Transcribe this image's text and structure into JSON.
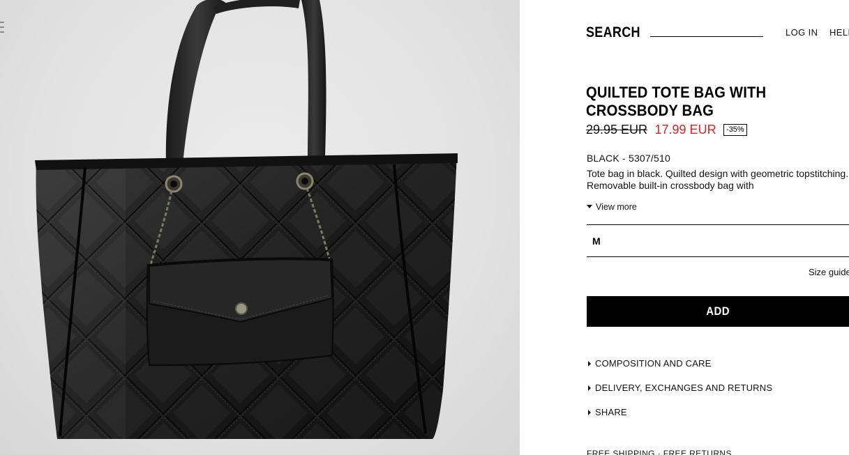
{
  "header": {
    "search_label": "SEARCH",
    "login_label": "LOG IN",
    "help_label": "HELP"
  },
  "product": {
    "title": "QUILTED TOTE BAG WITH CROSSBODY BAG",
    "old_price": "29.95 EUR",
    "new_price": "17.99 EUR",
    "discount": "-35%",
    "color_ref": "BLACK - 5307/510",
    "description": "Tote bag in black. Quilted design with geometric topstitching. Removable built-in crossbody bag with",
    "view_more_label": "View more",
    "selected_size": "M",
    "size_guide_label": "Size guide",
    "add_label": "ADD"
  },
  "accordion": [
    {
      "label": "COMPOSITION AND CARE"
    },
    {
      "label": "DELIVERY, EXCHANGES AND RETURNS"
    },
    {
      "label": "SHARE"
    }
  ],
  "footer": {
    "shipping_text": "FREE SHIPPING  ·  FREE RETURNS"
  },
  "colors": {
    "sale_price": "#e01f26",
    "add_button_bg": "#000000",
    "add_button_text": "#ffffff"
  },
  "icons": {
    "menu": "hamburger-menu-icon",
    "view_more": "caret-down-icon",
    "accordion": "caret-right-icon"
  }
}
